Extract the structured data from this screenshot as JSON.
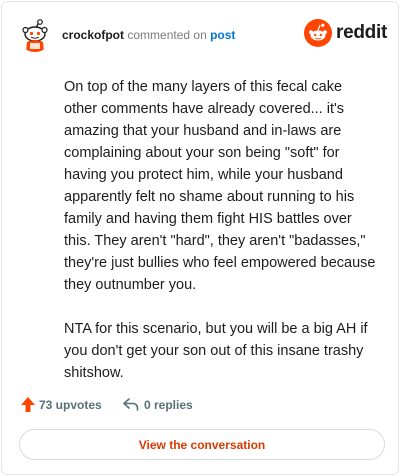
{
  "header": {
    "username": "crockofpot",
    "action_text": "commented on",
    "post_link": "post",
    "brand": "reddit"
  },
  "comment": {
    "paragraphs": [
      "On top of the many layers of this fecal cake other comments have already covered... it's amazing that your husband and in-laws are complaining about your son being \"soft\" for having you protect him, while your husband apparently felt no shame about running to his family and having them fight HIS battles over this. They aren't \"hard\", they aren't \"badasses,\" they're just bullies who feel empowered because they outnumber you.",
      "NTA for this scenario, but you will be a big AH if you don't get your son out of this insane trashy shitshow."
    ]
  },
  "stats": {
    "upvotes": "73 upvotes",
    "replies": "0 replies"
  },
  "cta_label": "View the conversation",
  "colors": {
    "accent": "#ff4500",
    "link": "#0079d3",
    "cta_text": "#d93a00"
  },
  "icons": [
    "snoo-avatar-icon",
    "reddit-logo-icon",
    "upvote-arrow-icon",
    "reply-arrow-icon"
  ]
}
